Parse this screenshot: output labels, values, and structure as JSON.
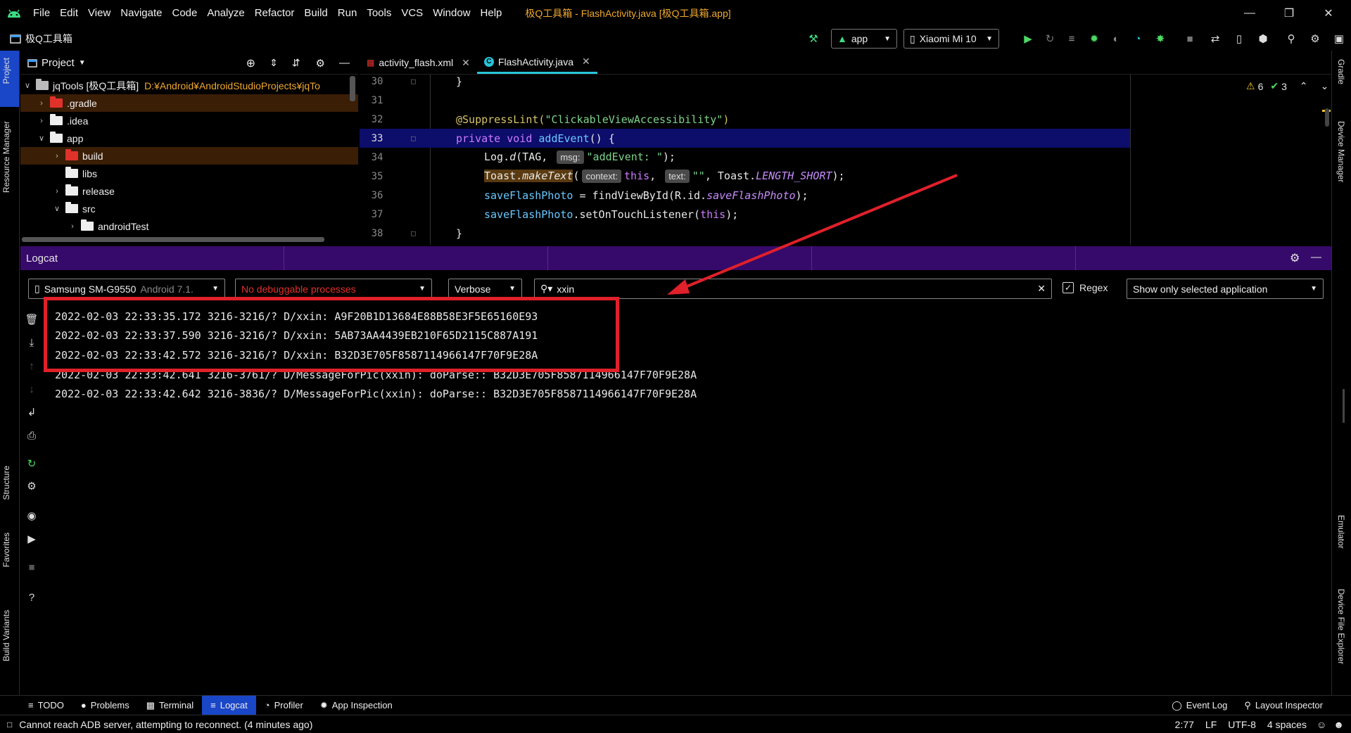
{
  "menubar": {
    "items": [
      "File",
      "Edit",
      "View",
      "Navigate",
      "Code",
      "Analyze",
      "Refactor",
      "Build",
      "Run",
      "Tools",
      "VCS",
      "Window",
      "Help"
    ],
    "window_title": "极Q工具箱 - FlashActivity.java [极Q工具箱.app]"
  },
  "navbar": {
    "project_name": "极Q工具箱",
    "run_config": "app",
    "device": "Xiaomi Mi 10"
  },
  "left_strip": [
    "Project",
    "Resource Manager",
    "Structure",
    "Favorites",
    "Build Variants"
  ],
  "right_strip": [
    "Gradle",
    "Device Manager",
    "Emulator",
    "Device File Explorer"
  ],
  "project_panel": {
    "title": "Project",
    "tree": [
      {
        "label": "jqTools [极Q工具箱]",
        "path": "D:¥Android¥AndroidStudioProjects¥jqTo"
      },
      {
        "label": ".gradle"
      },
      {
        "label": ".idea"
      },
      {
        "label": "app"
      },
      {
        "label": "build"
      },
      {
        "label": "libs"
      },
      {
        "label": "release"
      },
      {
        "label": "src"
      },
      {
        "label": "androidTest"
      }
    ]
  },
  "editor": {
    "tabs": [
      {
        "label": "activity_flash.xml"
      },
      {
        "label": "FlashActivity.java"
      }
    ],
    "line_numbers": [
      "30",
      "31",
      "32",
      "33",
      "34",
      "35",
      "36",
      "37",
      "38"
    ],
    "inspection": {
      "warnings": "6",
      "checks": "3"
    },
    "code": {
      "l30": "}",
      "l32_ann": "@SuppressLint(",
      "l32_str": "\"ClickableViewAccessibility\"",
      "l32_end": ")",
      "l33_kw": "private void ",
      "l33_fn": "addEvent",
      "l33_end": "() {",
      "l34_a": "Log.",
      "l34_b": "d",
      "l34_c": "(TAG, ",
      "l34_hint": "msg:",
      "l34_str": "\"addEvent: \"",
      "l34_end": ");",
      "l35_a": "Toast.",
      "l35_b": "makeText",
      "l35_c": "(",
      "l35_hint1": "context:",
      "l35_kw": "this",
      "l35_d": ", ",
      "l35_hint2": "text:",
      "l35_str": "\"\"",
      "l35_e": ", Toast.",
      "l35_const": "LENGTH_SHORT",
      "l35_end": ");",
      "l36_a": "saveFlashPhoto",
      "l36_b": " = findViewById(R.id.",
      "l36_c": "saveFlashPhoto",
      "l36_end": ");",
      "l37_a": "saveFlashPhoto",
      "l37_b": ".setOnTouchListener(",
      "l37_kw": "this",
      "l37_end": ");",
      "l38": "}"
    }
  },
  "logcat": {
    "title": "Logcat",
    "device": "Samsung SM-G9550",
    "device_os": "Android 7.1.",
    "process": "No debuggable processes",
    "level": "Verbose",
    "search": "xxin",
    "regex_label": "Regex",
    "filter": "Show only selected application",
    "lines": [
      "2022-02-03 22:33:35.172 3216-3216/? D/xxin: A9F20B1D13684E88B58E3F5E65160E93",
      "2022-02-03 22:33:37.590 3216-3216/? D/xxin: 5AB73AA4439EB210F65D2115C887A191",
      "2022-02-03 22:33:42.572 3216-3216/? D/xxin: B32D3E705F8587114966147F70F9E28A",
      "2022-02-03 22:33:42.641 3216-3761/? D/MessageForPic(xxin): doParse:: B32D3E705F8587114966147F70F9E28A",
      "2022-02-03 22:33:42.642 3216-3836/? D/MessageForPic(xxin): doParse:: B32D3E705F8587114966147F70F9E28A"
    ]
  },
  "bottom_tools": [
    "TODO",
    "Problems",
    "Terminal",
    "Logcat",
    "Profiler",
    "App Inspection"
  ],
  "bottom_right_tools": [
    "Event Log",
    "Layout Inspector"
  ],
  "status": {
    "message": "Cannot reach ADB server, attempting to reconnect. (4 minutes ago)",
    "position": "2:77",
    "line_sep": "LF",
    "encoding": "UTF-8",
    "indent": "4 spaces"
  },
  "colors": {
    "accent_highlight": "#e0202a",
    "logcat_bar": "#360a6a",
    "current_line": "#0d0d6b",
    "active_tool": "#1a46c8"
  }
}
